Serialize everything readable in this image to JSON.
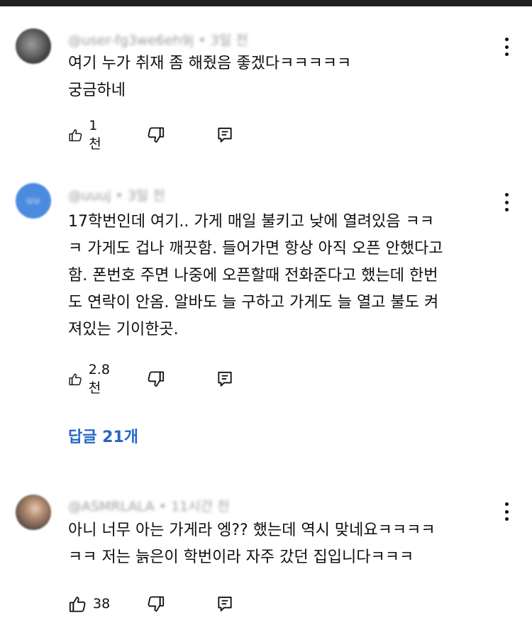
{
  "comments": [
    {
      "author_meta": "@user-fg3we6eh9j • 3일 전",
      "lines": [
        "여기 누가 취재 좀 해줬음 좋겠다ㅋㅋㅋㅋㅋ",
        "궁금하네"
      ],
      "likes": "1천",
      "avatar_icon": "avatar-photo-icon"
    },
    {
      "author_meta": "@uuuj • 3일 전",
      "lines": [
        "17학번인데 여기.. 가게 매일 불키고 낮에 열려있음 ㅋㅋ",
        "ㅋ 가게도 겁나 깨끗함. 들어가면 항상 아직 오픈 안했다고",
        "함. 폰번호 주면 나중에 오픈할때 전화준다고 했는데 한번",
        "도 연락이 안옴. 알바도 늘 구하고 가게도 늘 열고 불도 켜",
        "져있는 기이한곳."
      ],
      "likes": "2.8천",
      "avatar_text": "uu"
    },
    {
      "author_meta": "@ASMRLALA • 11시간 전",
      "lines": [
        "아니 너무 아는 가게라 엥?? 했는데 역시 맞네요ㅋㅋㅋㅋ",
        "ㅋㅋ 저는 늙은이 학번이라 자주 갔던 집입니다ㅋㅋㅋ"
      ],
      "likes": "38"
    }
  ],
  "replies_label": "답글 21개",
  "colors": {
    "link": "#2566c8",
    "text": "#0f0f0f",
    "meta": "#9e9e9e"
  },
  "icons": [
    "thumbs-up-icon",
    "thumbs-down-icon",
    "reply-icon",
    "more-vert-icon"
  ]
}
